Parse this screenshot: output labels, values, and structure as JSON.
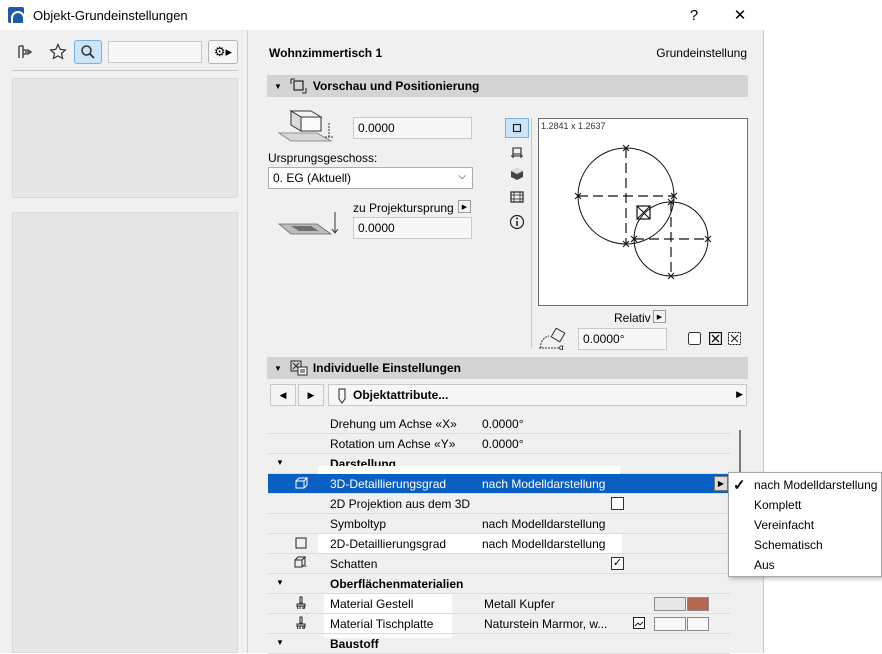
{
  "window": {
    "title": "Objekt-Grundeinstellungen",
    "help": "?",
    "close": "✕"
  },
  "object": {
    "name": "Wohnzimmertisch 1",
    "mode": "Grundeinstellung"
  },
  "preview_section": {
    "title": "Vorschau und Positionierung",
    "elevation_value": "0.0000",
    "story_label": "Ursprungsgeschoss:",
    "story_value": "0. EG (Aktuell)",
    "project_origin_label": "zu Projektursprung",
    "origin_value": "0.0000",
    "preview_size": "1.2841 x 1.2637",
    "relative_label": "Relativ",
    "angle_value": "0.0000°"
  },
  "settings_section": {
    "title": "Individuelle Einstellungen",
    "object_attributes": "Objektattribute..."
  },
  "table": {
    "rows": [
      {
        "type": "prop",
        "name": "Drehung um Achse «X»",
        "value": "0.0000°"
      },
      {
        "type": "prop",
        "name": "Rotation um Achse «Y»",
        "value": "0.0000°"
      },
      {
        "type": "group",
        "name": "Darstellung"
      },
      {
        "type": "prop",
        "name": "3D-Detaillierungsgrad",
        "value": "nach Modelldarstellung"
      },
      {
        "type": "prop",
        "name": "2D Projektion aus dem 3D",
        "value": ""
      },
      {
        "type": "prop",
        "name": "Symboltyp",
        "value": "nach Modelldarstellung"
      },
      {
        "type": "prop",
        "name": "2D-Detaillierungsgrad",
        "value": "nach Modelldarstellung"
      },
      {
        "type": "prop",
        "name": "Schatten",
        "value": ""
      },
      {
        "type": "group",
        "name": "Oberflächenmaterialien"
      },
      {
        "type": "prop",
        "name": "Material Gestell",
        "value": "Metall Kupfer"
      },
      {
        "type": "prop",
        "name": "Material Tischplatte",
        "value": "Naturstein Marmor, w..."
      },
      {
        "type": "group",
        "name": "Baustoff"
      }
    ],
    "copper_color": "#b5674f",
    "selection_color": "#0a5fc4"
  },
  "dropdown": {
    "items": [
      "nach Modelldarstellung",
      "Komplett",
      "Vereinfacht",
      "Schematisch",
      "Aus"
    ],
    "selected": "nach Modelldarstellung"
  }
}
